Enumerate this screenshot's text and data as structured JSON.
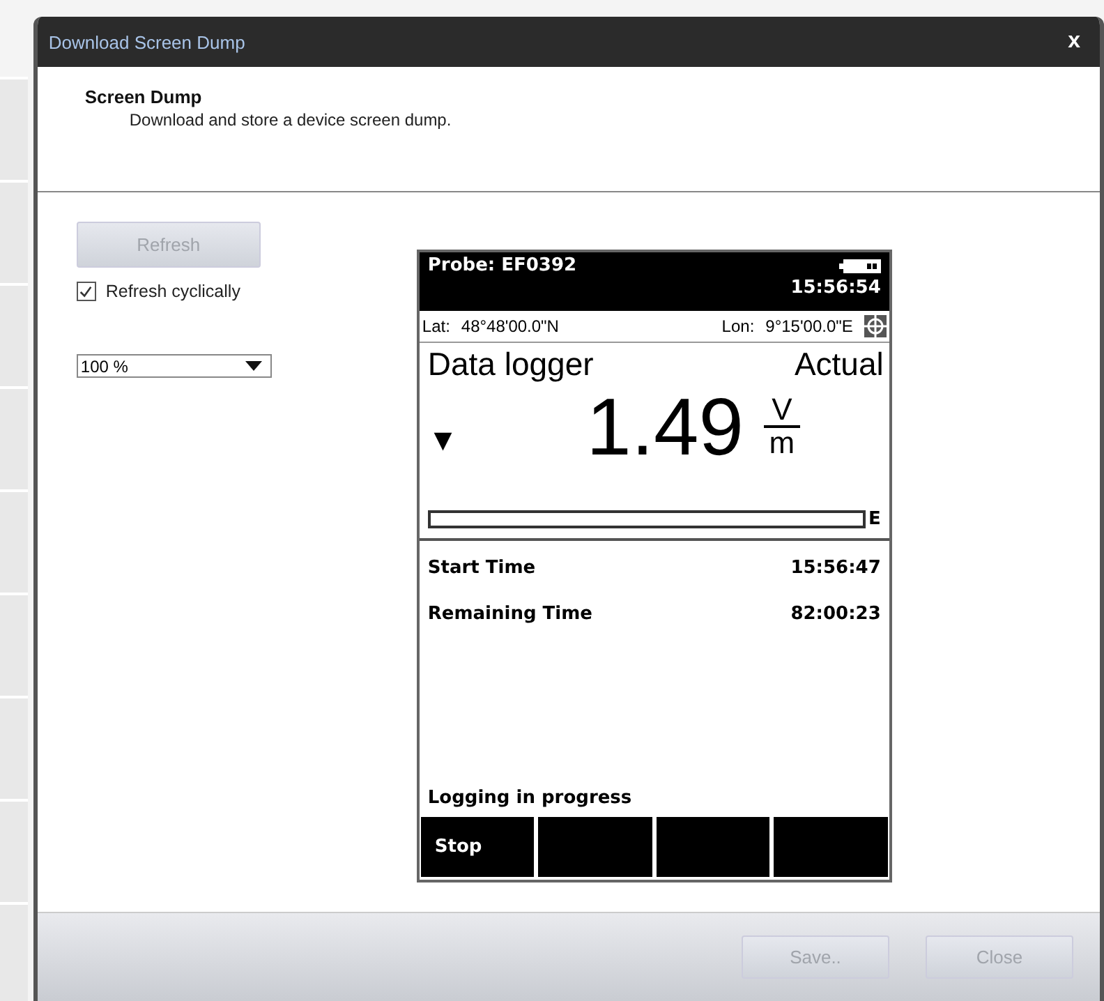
{
  "window": {
    "title": "Download Screen Dump",
    "close": "x"
  },
  "header": {
    "title": "Screen Dump",
    "description": "Download and store a device screen dump."
  },
  "refresh_button": {
    "label": "Refresh",
    "disabled": true
  },
  "refresh_cyclically": {
    "label": "Refresh cyclically",
    "checked": true
  },
  "zoom_select": {
    "value": "100 %"
  },
  "device": {
    "probe": "Probe: EF0392",
    "time": "15:56:54",
    "lat_label": "Lat:",
    "lat": "48°48'00.0\"N",
    "lon_label": "Lon:",
    "lon": "9°15'00.0\"E",
    "mode": "Data logger",
    "measure": "Actual",
    "value": "1.49",
    "unit_top": "V",
    "unit_bottom": "m",
    "trend": "▼",
    "bar": {
      "level": 0,
      "label": "E"
    },
    "rows": [
      {
        "label": "Start Time",
        "value": "15:56:47"
      },
      {
        "label": "Remaining Time",
        "value": "82:00:23"
      }
    ],
    "status": "Logging in progress",
    "softkeys": [
      "Stop"
    ]
  },
  "buttons": [
    {
      "label": "Save..",
      "disabled": true
    },
    {
      "label": "Close",
      "disabled": true
    }
  ]
}
